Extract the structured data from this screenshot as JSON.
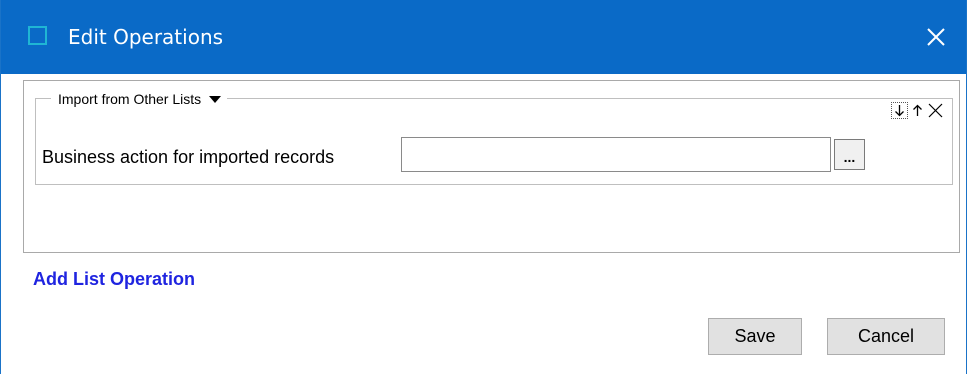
{
  "window": {
    "title": "Edit Operations",
    "app_icon": "window-square-icon",
    "close_icon": "close-icon",
    "titlebar_color": "#0a6ac7"
  },
  "operation": {
    "legend_label": "Import from Other Lists",
    "legend_icon": "caret-down-icon",
    "toolbar_icons": [
      "move-down-icon",
      "move-up-icon",
      "remove-icon"
    ],
    "field_label": "Business action for imported records",
    "field_value": "",
    "browse_label": "..."
  },
  "links": {
    "add_operation": "Add List Operation",
    "color": "#1f24e0"
  },
  "footer": {
    "save_label": "Save",
    "cancel_label": "Cancel"
  }
}
